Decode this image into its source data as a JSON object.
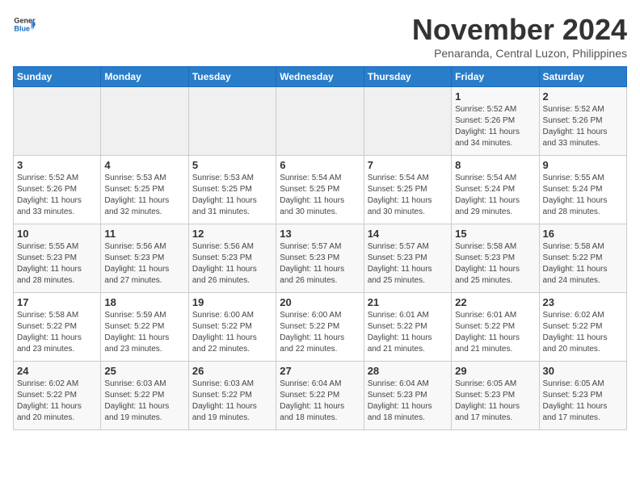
{
  "header": {
    "logo_general": "General",
    "logo_blue": "Blue",
    "month_title": "November 2024",
    "subtitle": "Penaranda, Central Luzon, Philippines"
  },
  "weekdays": [
    "Sunday",
    "Monday",
    "Tuesday",
    "Wednesday",
    "Thursday",
    "Friday",
    "Saturday"
  ],
  "weeks": [
    [
      {
        "day": "",
        "detail": ""
      },
      {
        "day": "",
        "detail": ""
      },
      {
        "day": "",
        "detail": ""
      },
      {
        "day": "",
        "detail": ""
      },
      {
        "day": "",
        "detail": ""
      },
      {
        "day": "1",
        "detail": "Sunrise: 5:52 AM\nSunset: 5:26 PM\nDaylight: 11 hours\nand 34 minutes."
      },
      {
        "day": "2",
        "detail": "Sunrise: 5:52 AM\nSunset: 5:26 PM\nDaylight: 11 hours\nand 33 minutes."
      }
    ],
    [
      {
        "day": "3",
        "detail": "Sunrise: 5:52 AM\nSunset: 5:26 PM\nDaylight: 11 hours\nand 33 minutes."
      },
      {
        "day": "4",
        "detail": "Sunrise: 5:53 AM\nSunset: 5:25 PM\nDaylight: 11 hours\nand 32 minutes."
      },
      {
        "day": "5",
        "detail": "Sunrise: 5:53 AM\nSunset: 5:25 PM\nDaylight: 11 hours\nand 31 minutes."
      },
      {
        "day": "6",
        "detail": "Sunrise: 5:54 AM\nSunset: 5:25 PM\nDaylight: 11 hours\nand 30 minutes."
      },
      {
        "day": "7",
        "detail": "Sunrise: 5:54 AM\nSunset: 5:25 PM\nDaylight: 11 hours\nand 30 minutes."
      },
      {
        "day": "8",
        "detail": "Sunrise: 5:54 AM\nSunset: 5:24 PM\nDaylight: 11 hours\nand 29 minutes."
      },
      {
        "day": "9",
        "detail": "Sunrise: 5:55 AM\nSunset: 5:24 PM\nDaylight: 11 hours\nand 28 minutes."
      }
    ],
    [
      {
        "day": "10",
        "detail": "Sunrise: 5:55 AM\nSunset: 5:23 PM\nDaylight: 11 hours\nand 28 minutes."
      },
      {
        "day": "11",
        "detail": "Sunrise: 5:56 AM\nSunset: 5:23 PM\nDaylight: 11 hours\nand 27 minutes."
      },
      {
        "day": "12",
        "detail": "Sunrise: 5:56 AM\nSunset: 5:23 PM\nDaylight: 11 hours\nand 26 minutes."
      },
      {
        "day": "13",
        "detail": "Sunrise: 5:57 AM\nSunset: 5:23 PM\nDaylight: 11 hours\nand 26 minutes."
      },
      {
        "day": "14",
        "detail": "Sunrise: 5:57 AM\nSunset: 5:23 PM\nDaylight: 11 hours\nand 25 minutes."
      },
      {
        "day": "15",
        "detail": "Sunrise: 5:58 AM\nSunset: 5:23 PM\nDaylight: 11 hours\nand 25 minutes."
      },
      {
        "day": "16",
        "detail": "Sunrise: 5:58 AM\nSunset: 5:22 PM\nDaylight: 11 hours\nand 24 minutes."
      }
    ],
    [
      {
        "day": "17",
        "detail": "Sunrise: 5:58 AM\nSunset: 5:22 PM\nDaylight: 11 hours\nand 23 minutes."
      },
      {
        "day": "18",
        "detail": "Sunrise: 5:59 AM\nSunset: 5:22 PM\nDaylight: 11 hours\nand 23 minutes."
      },
      {
        "day": "19",
        "detail": "Sunrise: 6:00 AM\nSunset: 5:22 PM\nDaylight: 11 hours\nand 22 minutes."
      },
      {
        "day": "20",
        "detail": "Sunrise: 6:00 AM\nSunset: 5:22 PM\nDaylight: 11 hours\nand 22 minutes."
      },
      {
        "day": "21",
        "detail": "Sunrise: 6:01 AM\nSunset: 5:22 PM\nDaylight: 11 hours\nand 21 minutes."
      },
      {
        "day": "22",
        "detail": "Sunrise: 6:01 AM\nSunset: 5:22 PM\nDaylight: 11 hours\nand 21 minutes."
      },
      {
        "day": "23",
        "detail": "Sunrise: 6:02 AM\nSunset: 5:22 PM\nDaylight: 11 hours\nand 20 minutes."
      }
    ],
    [
      {
        "day": "24",
        "detail": "Sunrise: 6:02 AM\nSunset: 5:22 PM\nDaylight: 11 hours\nand 20 minutes."
      },
      {
        "day": "25",
        "detail": "Sunrise: 6:03 AM\nSunset: 5:22 PM\nDaylight: 11 hours\nand 19 minutes."
      },
      {
        "day": "26",
        "detail": "Sunrise: 6:03 AM\nSunset: 5:22 PM\nDaylight: 11 hours\nand 19 minutes."
      },
      {
        "day": "27",
        "detail": "Sunrise: 6:04 AM\nSunset: 5:22 PM\nDaylight: 11 hours\nand 18 minutes."
      },
      {
        "day": "28",
        "detail": "Sunrise: 6:04 AM\nSunset: 5:23 PM\nDaylight: 11 hours\nand 18 minutes."
      },
      {
        "day": "29",
        "detail": "Sunrise: 6:05 AM\nSunset: 5:23 PM\nDaylight: 11 hours\nand 17 minutes."
      },
      {
        "day": "30",
        "detail": "Sunrise: 6:05 AM\nSunset: 5:23 PM\nDaylight: 11 hours\nand 17 minutes."
      }
    ]
  ]
}
